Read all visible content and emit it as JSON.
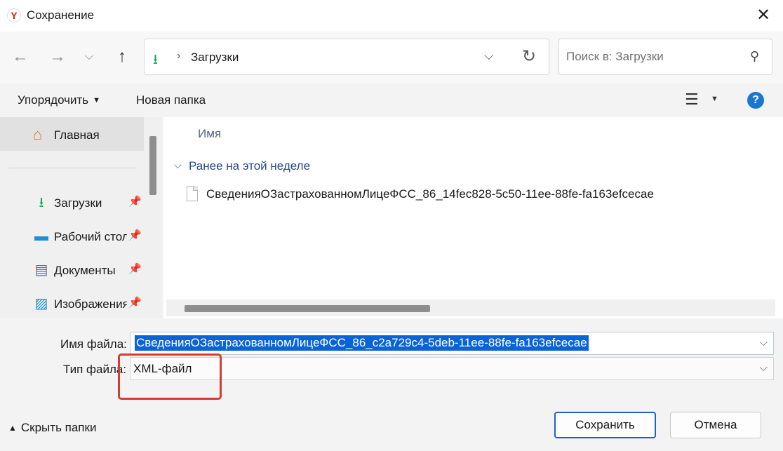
{
  "window": {
    "title": "Сохранение",
    "close_glyph": "✕",
    "logo_letter": "Y"
  },
  "nav": {
    "back_glyph": "←",
    "forward_glyph": "→",
    "recent_glyph": "⌵",
    "up_glyph": "↑"
  },
  "address": {
    "icon_glyph": "⭳",
    "separator": "›",
    "location": "Загрузки",
    "dropdown_glyph": "⌵",
    "refresh_glyph": "↻"
  },
  "search": {
    "placeholder": "Поиск в: Загрузки",
    "icon_glyph": "⚲"
  },
  "commands": {
    "organize_label": "Упорядочить",
    "organize_caret": "▼",
    "new_folder_label": "Новая папка",
    "view_glyph": "☰",
    "view_caret": "▼",
    "help_glyph": "?"
  },
  "sidebar": {
    "home": {
      "label": "Главная",
      "icon_glyph": "⌂"
    },
    "quick_access": [
      {
        "label": "Загрузки",
        "icon": "download-icon",
        "icon_glyph": "⭳",
        "icon_color": "#1aa45b",
        "pin_glyph": "📌"
      },
      {
        "label": "Рабочий стол",
        "icon": "desktop-icon",
        "icon_glyph": "▬",
        "icon_color": "#1e8fd6",
        "pin_glyph": "📌"
      },
      {
        "label": "Документы",
        "icon": "documents-icon",
        "icon_glyph": "▤",
        "icon_color": "#5a6f8a",
        "pin_glyph": "📌"
      },
      {
        "label": "Изображения",
        "icon": "pictures-icon",
        "icon_glyph": "▨",
        "icon_color": "#1e8fd6",
        "pin_glyph": "📌"
      }
    ]
  },
  "content": {
    "column_header": "Имя",
    "group": {
      "label": "Ранее на этой неделе",
      "chevron_glyph": "⌵"
    },
    "files": [
      {
        "name": "СведенияОЗастрахованномЛицеФСС_86_14fec828-5c50-11ee-88fe-fa163efcecae"
      }
    ]
  },
  "save_form": {
    "filename_label": "Имя файла:",
    "filename_value": "СведенияОЗастрахованномЛицеФСС_86_c2a729c4-5deb-11ee-88fe-fa163efcecae",
    "filetype_label": "Тип файла:",
    "filetype_value": "XML-файл",
    "dropdown_glyph": "⌵",
    "highlight_color": "#d43b33"
  },
  "footer": {
    "hide_folders_label": "Скрыть папки",
    "hide_folders_chevron": "▲",
    "save_label": "Сохранить",
    "cancel_label": "Отмена"
  },
  "colors": {
    "accent": "#1d64c2",
    "selection": "#0a64d8",
    "help": "#1777d1"
  }
}
